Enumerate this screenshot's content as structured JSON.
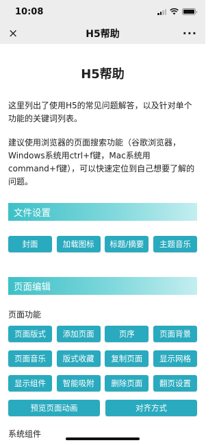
{
  "status_bar": {
    "time": "10:08"
  },
  "nav": {
    "close_icon": "×",
    "title": "H5帮助",
    "more_icon": "···"
  },
  "page": {
    "title": "H5帮助",
    "intro_1": "这里列出了使用H5的常见问题解答，以及针对单个功能的关键词列表。",
    "intro_2": "建议使用浏览器的页面搜索功能（谷歌浏览器，Windows系统用ctrl+f键，Mac系统用command+f键），可以快速定位到自己想要了解的问题。"
  },
  "sections": {
    "file_settings": {
      "title": "文件设置",
      "buttons": [
        "封面",
        "加载图标",
        "标题/摘要",
        "主题音乐"
      ]
    },
    "page_edit": {
      "title": "页面编辑",
      "sub_label": "页面功能",
      "rows": [
        [
          "页面版式",
          "添加页面",
          "页序",
          "页面背景"
        ],
        [
          "页面音乐",
          "版式收藏",
          "复制页面",
          "显示网格"
        ],
        [
          "显示组件",
          "智能吸附",
          "删除页面",
          "翻页设置"
        ],
        [
          "预览页面动画",
          "对齐方式"
        ]
      ]
    },
    "next_label": "系统组件"
  },
  "colors": {
    "accent": "#2aaabe",
    "section_gradient_start": "#3dc0c7",
    "header_bg": "#ededed"
  }
}
